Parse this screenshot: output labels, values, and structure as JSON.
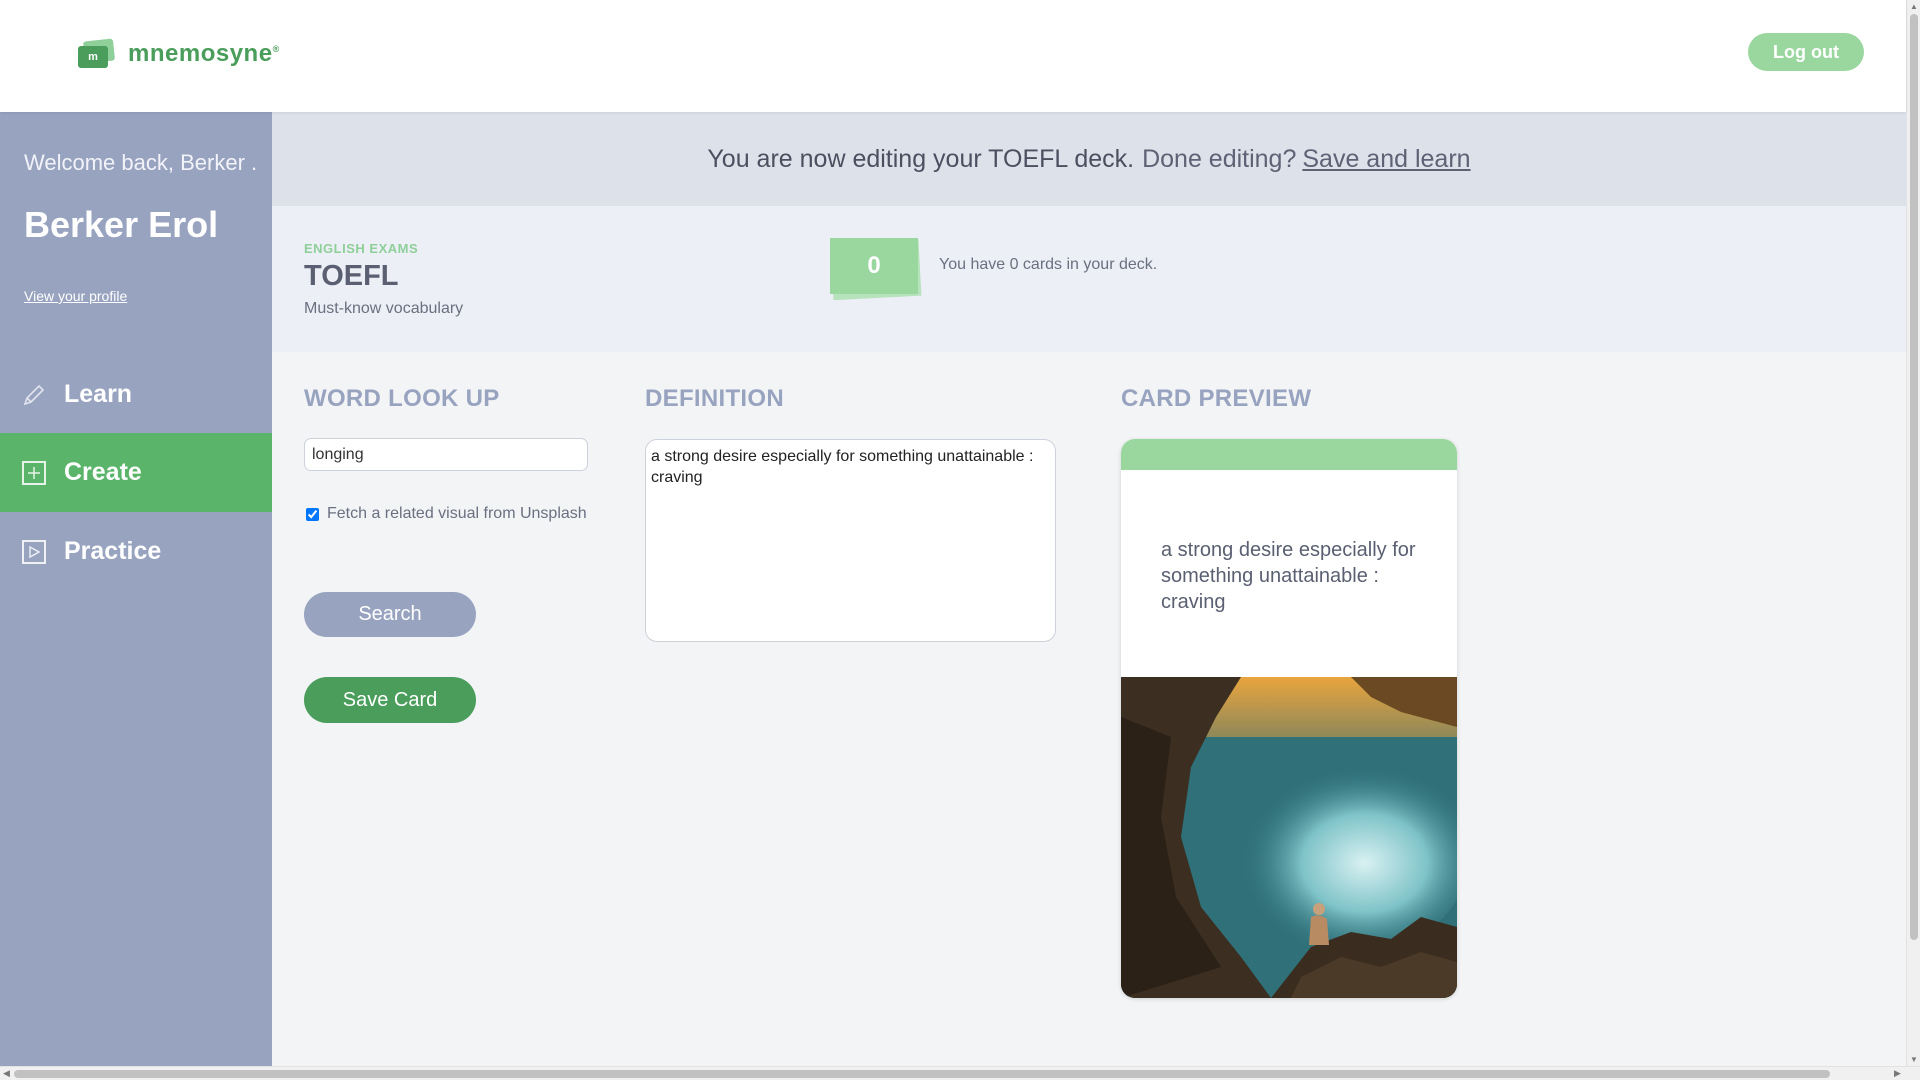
{
  "header": {
    "logo_badge": "m",
    "logo_text": "mnemosyne",
    "logout_label": "Log out"
  },
  "sidebar": {
    "welcome": "Welcome back, Berker .",
    "username": "Berker Erol",
    "profile_link": "View your profile",
    "items": [
      {
        "label": "Learn",
        "icon": "pencil-icon",
        "active": false
      },
      {
        "label": "Create",
        "icon": "plus-square-icon",
        "active": true
      },
      {
        "label": "Practice",
        "icon": "play-square-icon",
        "active": false
      }
    ]
  },
  "banner": {
    "editing_text": "You are now editing your TOEFL deck.",
    "done_text": "Done editing?",
    "save_link": "Save and learn"
  },
  "deck": {
    "category": "ENGLISH EXAMS",
    "name": "TOEFL",
    "subtitle": "Must-know vocabulary",
    "card_count": "0",
    "count_text": "You have 0 cards in your deck."
  },
  "lookup": {
    "title": "WORD LOOK UP",
    "word_value": "longing",
    "fetch_label": "Fetch a related visual from Unsplash",
    "fetch_checked": true,
    "search_label": "Search",
    "save_label": "Save Card"
  },
  "definition": {
    "title": "DEFINITION",
    "value": "a strong desire especially for something unattainable : craving"
  },
  "preview": {
    "title": "CARD PREVIEW",
    "text": "a strong desire especially for something unattainable : craving"
  },
  "colors": {
    "brand_green": "#4a9d5b",
    "light_green": "#9ad79f",
    "sidebar_blue": "#98a3c0",
    "active_green": "#5ab46a"
  }
}
